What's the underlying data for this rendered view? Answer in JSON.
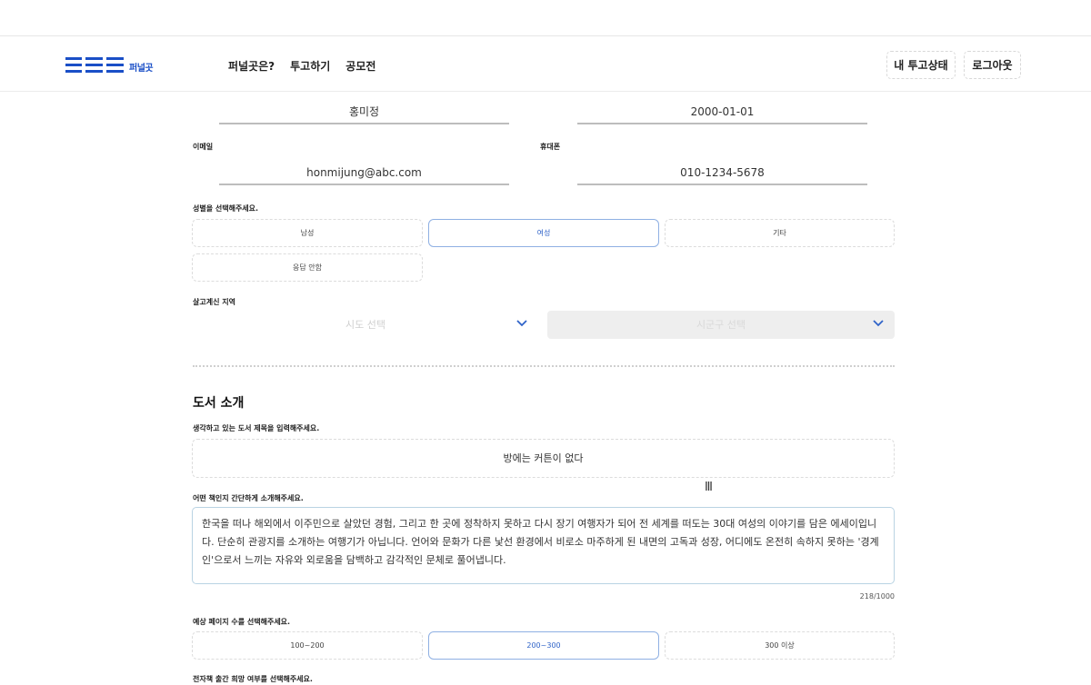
{
  "header": {
    "logo_text": "퍼널곳",
    "nav": [
      "퍼널곳은?",
      "투고하기",
      "공모전"
    ],
    "my_status_label": "내 투고상태",
    "logout_label": "로그아웃"
  },
  "profile": {
    "name_value": "홍미정",
    "birth_value": "2000-01-01",
    "email_label": "이메일",
    "email_value": "honmijung@abc.com",
    "phone_label": "휴대폰",
    "phone_value": "010-1234-5678"
  },
  "gender": {
    "label": "성별을 선택해주세요.",
    "options": [
      "남성",
      "여성",
      "기타",
      "응답 안함"
    ],
    "selected": "여성"
  },
  "region": {
    "label": "살고계신 지역",
    "city_placeholder": "시도 선택",
    "district_placeholder": "시군구 선택"
  },
  "book": {
    "section_title": "도서 소개",
    "title_prompt": "생각하고 있는 도서 제목을 입력해주세요.",
    "title_value": "방에는 커튼이 없다",
    "desc_prompt": "어떤 책인지 간단하게 소개해주세요.",
    "desc_value": "한국을 떠나 해외에서 이주민으로 살았던 경험, 그리고 한 곳에 정착하지 못하고 다시 장기 여행자가 되어 전 세계를 떠도는 30대 여성의 이야기를 담은 에세이입니다. 단순히 관광지를 소개하는 여행기가 아닙니다. 언어와 문화가 다른 낯선 환경에서 비로소 마주하게 된 내면의 고독과 성장, 어디에도 온전히 속하지 못하는 '경계인'으로서 느끼는 자유와 외로움을 담백하고 감각적인 문체로 풀어냅니다.",
    "char_count": "218/1000",
    "pages_label": "예상 페이지 수를 선택해주세요.",
    "page_options": [
      "100~200",
      "200~300",
      "300 이상"
    ],
    "page_selected": "200~300",
    "ebook_label": "전자책 출간 희망 여부를 선택해주세요."
  },
  "colors": {
    "accent": "#2f63c8",
    "logo": "#1a4fc7",
    "selected_border": "#8fb0e3"
  }
}
